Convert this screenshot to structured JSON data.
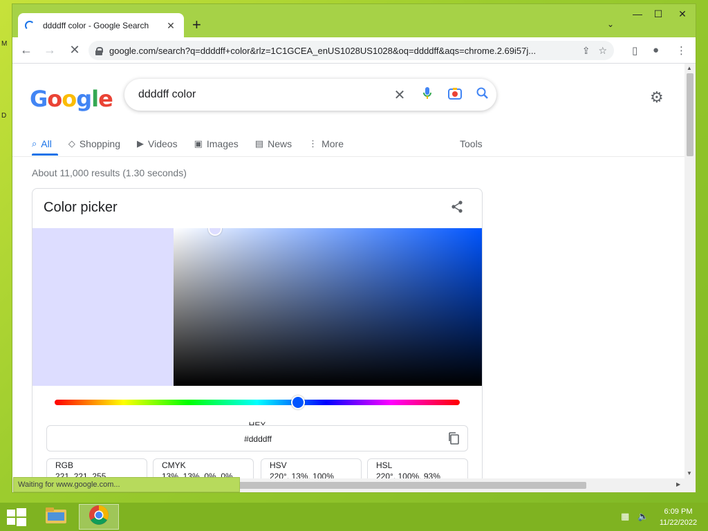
{
  "desktop": {
    "letters": [
      "M",
      "D"
    ]
  },
  "browser": {
    "tab_title": "ddddff color - Google Search",
    "url": "google.com/search?q=ddddff+color&rlz=1C1GCEA_enUS1028US1028&oq=ddddff&aqs=chrome.2.69i57j...",
    "status_text": "Waiting for www.google.com..."
  },
  "google": {
    "logo_letters": [
      "G",
      "o",
      "o",
      "g",
      "l",
      "e"
    ],
    "logo_colors": [
      "#4285f4",
      "#ea4335",
      "#fbbc05",
      "#4285f4",
      "#34a853",
      "#ea4335"
    ],
    "search_query": "ddddff color",
    "nav_tabs": [
      {
        "label": "All",
        "icon": "search-icon"
      },
      {
        "label": "Shopping",
        "icon": "tag-icon"
      },
      {
        "label": "Videos",
        "icon": "play-icon"
      },
      {
        "label": "Images",
        "icon": "image-icon"
      },
      {
        "label": "News",
        "icon": "news-icon"
      },
      {
        "label": "More",
        "icon": "more-vertical-icon"
      }
    ],
    "tools_label": "Tools",
    "results_count": "About 11,000 results (1.30 seconds)"
  },
  "color_picker": {
    "title": "Color picker",
    "selected_color": "#ddddff",
    "hue_color": "#0055ff",
    "hue_position": 0.6,
    "hex_label": "HEX",
    "hex_value": "#ddddff",
    "formats": [
      {
        "label": "RGB",
        "value": "221, 221, 255"
      },
      {
        "label": "CMYK",
        "value": "13%, 13%, 0%, 0%"
      },
      {
        "label": "HSV",
        "value": "220°, 13%, 100%"
      },
      {
        "label": "HSL",
        "value": "220°, 100%, 93%"
      }
    ]
  },
  "taskbar": {
    "time": "6:09 PM",
    "date": "11/22/2022"
  }
}
